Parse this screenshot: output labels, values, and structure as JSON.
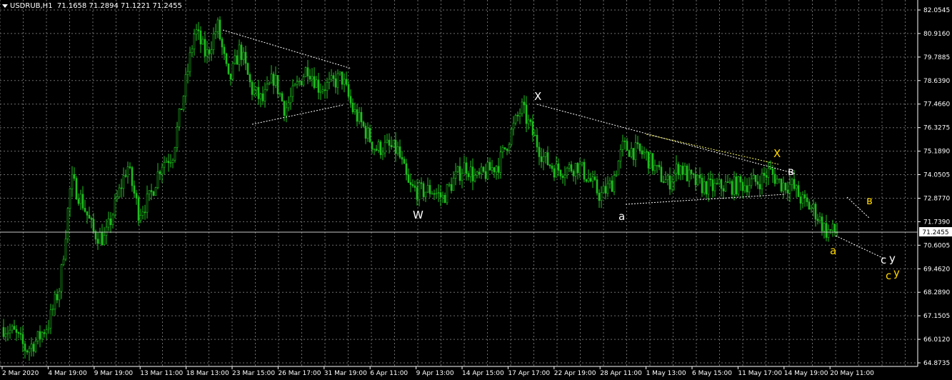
{
  "header": {
    "symbol_period": "USDRUB,H1",
    "ohlc": "71.1658 71.2894 71.1221 71.2455"
  },
  "colors": {
    "background": "#000000",
    "candle": "#1fbf1f",
    "grid": "#6e6e6e",
    "axis_text": "#ffffff",
    "price_line": "#c8c8c8",
    "wave_white": "#ffffff",
    "wave_yellow": "#ffd700"
  },
  "price_axis": {
    "labels": [
      "82.0545",
      "80.9160",
      "79.7885",
      "78.6390",
      "77.4660",
      "76.3275",
      "75.1890",
      "74.0505",
      "72.8770",
      "71.7390",
      "70.6005",
      "69.4620",
      "68.2890",
      "67.1505",
      "66.0120",
      "64.8735"
    ],
    "current_price": "71.2455"
  },
  "time_axis": {
    "labels": [
      "2 Mar 2020",
      "4 Mar 19:00",
      "9 Mar 19:00",
      "13 Mar 11:00",
      "18 Mar 13:00",
      "23 Mar 15:00",
      "26 Mar 17:00",
      "31 Mar 19:00",
      "6 Apr 11:00",
      "9 Apr 13:00",
      "14 Apr 15:00",
      "17 Apr 17:00",
      "22 Apr 19:00",
      "28 Apr 11:00",
      "1 May 13:00",
      "6 May 15:00",
      "11 May 17:00",
      "14 May 19:00",
      "20 May 11:00"
    ]
  },
  "wave_labels": {
    "white": [
      "X",
      "W",
      "a",
      "в",
      "c",
      "y"
    ],
    "yellow": [
      "X",
      "в",
      "a",
      "c",
      "y"
    ]
  },
  "chart_data": {
    "type": "candlestick",
    "symbol": "USDRUB",
    "timeframe": "H1",
    "ylim": [
      64.8735,
      82.0545
    ],
    "grid": true,
    "current_price": 71.2455,
    "close_path": [
      {
        "t": "2 Mar 2020",
        "v": 66.6
      },
      {
        "t": "3 Mar",
        "v": 66.3
      },
      {
        "t": "3 Mar",
        "v": 65.5
      },
      {
        "t": "4 Mar 19:00",
        "v": 66.0
      },
      {
        "t": "5 Mar",
        "v": 66.8
      },
      {
        "t": "6 Mar",
        "v": 68.6
      },
      {
        "t": "6 Mar",
        "v": 73.8
      },
      {
        "t": "9 Mar",
        "v": 72.7
      },
      {
        "t": "9 Mar 19:00",
        "v": 71.2
      },
      {
        "t": "10 Mar",
        "v": 70.9
      },
      {
        "t": "11 Mar",
        "v": 72.7
      },
      {
        "t": "12 Mar",
        "v": 74.5
      },
      {
        "t": "12 Mar",
        "v": 72.2
      },
      {
        "t": "13 Mar 11:00",
        "v": 72.9
      },
      {
        "t": "16 Mar",
        "v": 74.6
      },
      {
        "t": "17 Mar",
        "v": 75.0
      },
      {
        "t": "17 Mar",
        "v": 78.0
      },
      {
        "t": "18 Mar",
        "v": 81.1
      },
      {
        "t": "18 Mar 13:00",
        "v": 79.8
      },
      {
        "t": "19 Mar",
        "v": 81.3
      },
      {
        "t": "20 Mar",
        "v": 78.5
      },
      {
        "t": "23 Mar",
        "v": 80.2
      },
      {
        "t": "23 Mar 15:00",
        "v": 78.2
      },
      {
        "t": "24 Mar",
        "v": 77.6
      },
      {
        "t": "25 Mar",
        "v": 78.8
      },
      {
        "t": "25 Mar",
        "v": 77.2
      },
      {
        "t": "26 Mar 17:00",
        "v": 78.3
      },
      {
        "t": "27 Mar",
        "v": 79.3
      },
      {
        "t": "30 Mar",
        "v": 78.3
      },
      {
        "t": "31 Mar",
        "v": 78.4
      },
      {
        "t": "31 Mar 19:00",
        "v": 78.8
      },
      {
        "t": "1 Apr",
        "v": 77.2
      },
      {
        "t": "2 Apr",
        "v": 76.3
      },
      {
        "t": "3 Apr",
        "v": 75.3
      },
      {
        "t": "6 Apr 11:00",
        "v": 75.4
      },
      {
        "t": "7 Apr",
        "v": 75.2
      },
      {
        "t": "8 Apr",
        "v": 73.4
      },
      {
        "t": "9 Apr 13:00",
        "v": 73.2
      },
      {
        "t": "10 Apr",
        "v": 73.3
      },
      {
        "t": "13 Apr",
        "v": 72.9
      },
      {
        "t": "14 Apr",
        "v": 73.8
      },
      {
        "t": "14 Apr 15:00",
        "v": 74.5
      },
      {
        "t": "15 Apr",
        "v": 73.8
      },
      {
        "t": "16 Apr",
        "v": 74.2
      },
      {
        "t": "17 Apr",
        "v": 74.6
      },
      {
        "t": "17 Apr 17:00",
        "v": 76.0
      },
      {
        "t": "20 Apr",
        "v": 77.3
      },
      {
        "t": "21 Apr",
        "v": 76.0
      },
      {
        "t": "21 Apr",
        "v": 74.8
      },
      {
        "t": "22 Apr 19:00",
        "v": 74.3
      },
      {
        "t": "23 Apr",
        "v": 74.3
      },
      {
        "t": "24 Apr",
        "v": 74.5
      },
      {
        "t": "27 Apr",
        "v": 73.8
      },
      {
        "t": "28 Apr 11:00",
        "v": 73.0
      },
      {
        "t": "29 Apr",
        "v": 73.6
      },
      {
        "t": "30 Apr",
        "v": 75.4
      },
      {
        "t": "30 Apr",
        "v": 75.2
      },
      {
        "t": "1 May 13:00",
        "v": 75.0
      },
      {
        "t": "4 May",
        "v": 74.2
      },
      {
        "t": "5 May",
        "v": 73.6
      },
      {
        "t": "5 May",
        "v": 74.5
      },
      {
        "t": "6 May 15:00",
        "v": 73.8
      },
      {
        "t": "7 May",
        "v": 73.5
      },
      {
        "t": "8 May",
        "v": 73.4
      },
      {
        "t": "11 May",
        "v": 73.5
      },
      {
        "t": "11 May 17:00",
        "v": 73.5
      },
      {
        "t": "12 May",
        "v": 73.6
      },
      {
        "t": "13 May",
        "v": 73.7
      },
      {
        "t": "13 May",
        "v": 74.2
      },
      {
        "t": "14 May 19:00",
        "v": 73.6
      },
      {
        "t": "15 May",
        "v": 73.5
      },
      {
        "t": "18 May",
        "v": 72.7
      },
      {
        "t": "19 May",
        "v": 72.3
      },
      {
        "t": "20 May 11:00",
        "v": 71.3
      },
      {
        "t": "20 May",
        "v": 71.2455
      }
    ]
  }
}
